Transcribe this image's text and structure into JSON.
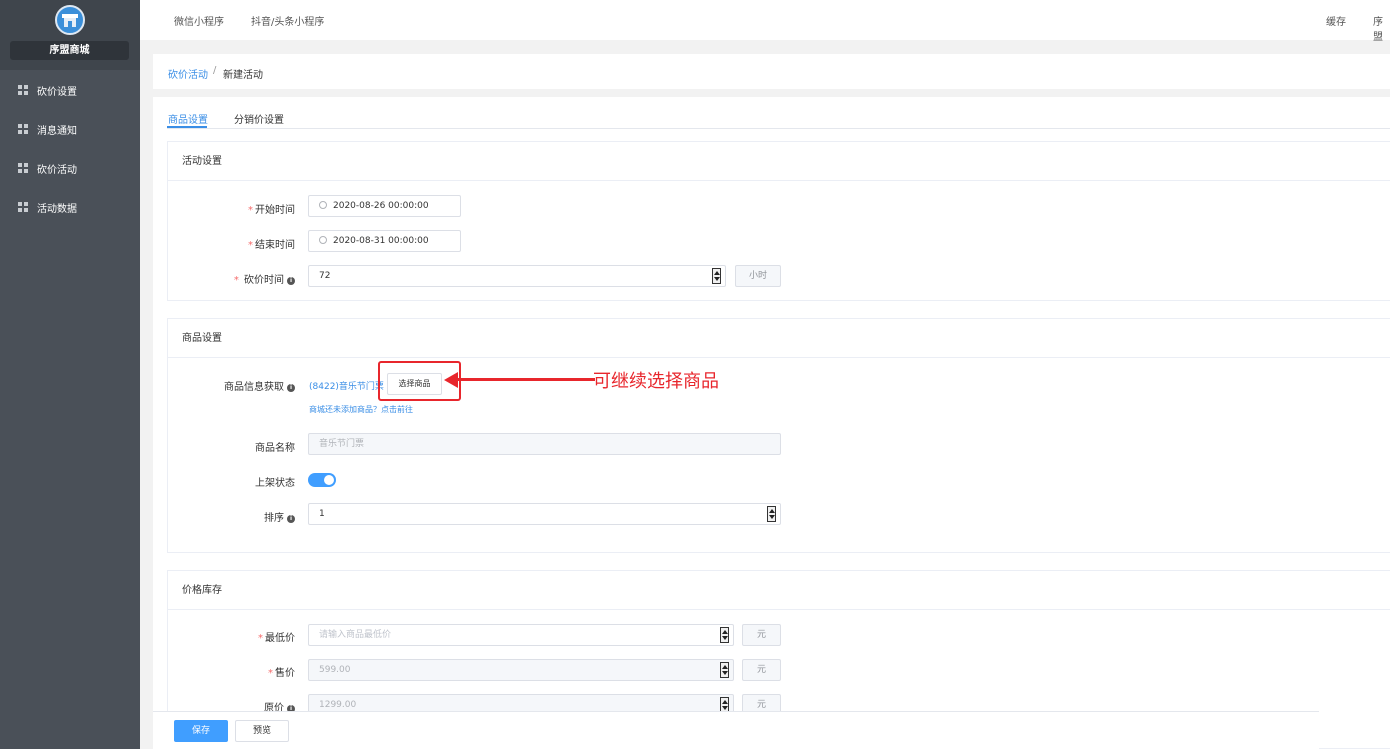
{
  "sidebar": {
    "shop_name": "序盟商城",
    "items": [
      {
        "label": "砍价设置"
      },
      {
        "label": "消息通知"
      },
      {
        "label": "砍价活动"
      },
      {
        "label": "活动数据"
      }
    ]
  },
  "topbar": {
    "links": [
      "微信小程序",
      "抖音/头条小程序"
    ],
    "cache": "缓存",
    "user": "序盟"
  },
  "breadcrumb": {
    "parent": "砍价活动",
    "separator": "/",
    "current": "新建活动"
  },
  "tabs": [
    {
      "label": "商品设置",
      "active": true
    },
    {
      "label": "分销价设置",
      "active": false
    }
  ],
  "activity_settings": {
    "title": "活动设置",
    "start_label": "开始时间",
    "start_value": "2020-08-26 00:00:00",
    "end_label": "结束时间",
    "end_value": "2020-08-31 00:00:00",
    "bargain_label": "砍价时间",
    "bargain_value": "72",
    "bargain_unit": "小时"
  },
  "goods_settings": {
    "title": "商品设置",
    "info_label": "商品信息获取",
    "selected_goods": "(8422)音乐节门票",
    "select_button": "选择商品",
    "hint_link": "商城还未添加商品？点击前往",
    "name_label": "商品名称",
    "name_value": "音乐节门票",
    "status_label": "上架状态",
    "status_on": true,
    "sort_label": "排序",
    "sort_value": "1"
  },
  "annotation": {
    "text": "可继续选择商品",
    "color": "#e8262c"
  },
  "price_stock": {
    "title": "价格库存",
    "min_label": "最低价",
    "min_placeholder": "请输入商品最低价",
    "sale_label": "售价",
    "sale_value": "599.00",
    "orig_label": "原价",
    "orig_value": "1299.00",
    "currency": "元"
  },
  "footer": {
    "save": "保存",
    "preview": "预览"
  },
  "colors": {
    "accent": "#409eff",
    "link": "#3a8ee6",
    "sidebar_bg": "#4a5058",
    "required": "#f56c6c"
  }
}
